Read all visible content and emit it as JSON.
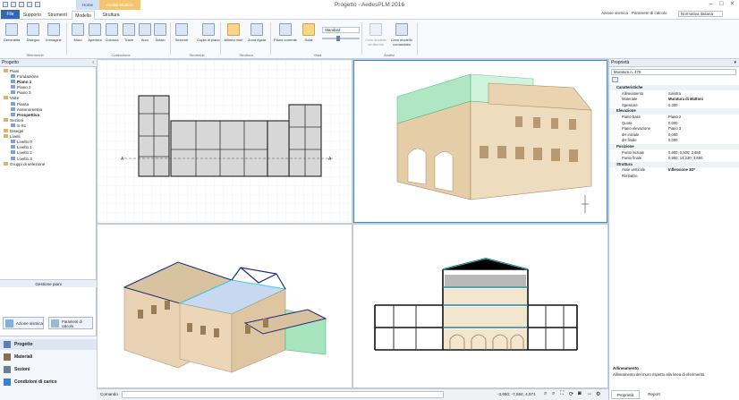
{
  "window": {
    "title": "Progetto - AedesPLM 2016"
  },
  "quick_access": {
    "context_tab": "Analisi Modello"
  },
  "tabs": [
    "File",
    "Supporto",
    "Strumenti",
    "Modello",
    "Struttura"
  ],
  "contextual_tabs": [
    "Home",
    "Analisi Modello"
  ],
  "top_right": {
    "analysis": "Azione sismica",
    "calc_params": "Parametri di calcolo",
    "norm": "Normativa italiana"
  },
  "ribbon": {
    "groups": [
      {
        "label": "Riferimenti",
        "buttons": [
          "Generalità",
          "Disegno",
          "Immagine"
        ]
      },
      {
        "label": "Costruzione",
        "buttons": [
          "Muro",
          "Apertura",
          "Colonna",
          "Trave",
          "Arco",
          "Solaio"
        ]
      },
      {
        "label": "Strumenti",
        "buttons": [
          "Sezione",
          "Copia di piano"
        ]
      },
      {
        "label": "Struttura",
        "buttons": [
          "Allinea muri",
          "Zona rigida"
        ]
      },
      {
        "label": "Vista",
        "buttons": [
          "Piano corrente",
          "Solai"
        ]
      },
      {
        "label": "Analisi",
        "buttons": [
          "Crea modello strutturale",
          "Crea modello comandato"
        ]
      }
    ],
    "view_select": "Standard"
  },
  "left_panel": {
    "header": "Progetto",
    "tree": [
      {
        "indent": 0,
        "label": "Piani",
        "bold": false
      },
      {
        "indent": 1,
        "label": "Fondazione",
        "bold": false
      },
      {
        "indent": 1,
        "label": "Piano 1",
        "bold": true
      },
      {
        "indent": 1,
        "label": "Piano 2",
        "bold": false
      },
      {
        "indent": 1,
        "label": "Piano 3",
        "bold": false
      },
      {
        "indent": 0,
        "label": "Viste",
        "bold": false
      },
      {
        "indent": 1,
        "label": "Pianta",
        "bold": false
      },
      {
        "indent": 1,
        "label": "Assonometria",
        "bold": false
      },
      {
        "indent": 1,
        "label": "Prospettiva",
        "bold": true
      },
      {
        "indent": 0,
        "label": "Sezioni",
        "bold": false
      },
      {
        "indent": 1,
        "label": "S-S1",
        "bold": false
      },
      {
        "indent": 0,
        "label": "Disegni",
        "bold": false
      },
      {
        "indent": 0,
        "label": "Livelli",
        "bold": false
      },
      {
        "indent": 1,
        "label": "Livello 0",
        "bold": false
      },
      {
        "indent": 1,
        "label": "Livello 1",
        "bold": false
      },
      {
        "indent": 1,
        "label": "Livello 2",
        "bold": false
      },
      {
        "indent": 1,
        "label": "Livello 3",
        "bold": false
      },
      {
        "indent": 0,
        "label": "Gruppi di selezione",
        "bold": false
      }
    ],
    "manager_label": "Gestione piani",
    "action_buttons": [
      "Azione sismica",
      "Parametri di calcolo"
    ],
    "nav_items": [
      "Progetto",
      "Materiali",
      "Sezioni",
      "Condizioni di carico"
    ]
  },
  "right_panel": {
    "header": "Proprietà",
    "selected": "Muratura n. 475",
    "rows": [
      {
        "type": "sec",
        "k": "Caratteristiche",
        "v": ""
      },
      {
        "type": "row",
        "k": "Allineamento",
        "v": "Sinistra"
      },
      {
        "type": "row",
        "k": "Materiale",
        "v": "Muratura di Mattoni",
        "bold": true
      },
      {
        "type": "row",
        "k": "Spessore",
        "v": "0,300"
      },
      {
        "type": "sec",
        "k": "Elevazione",
        "v": ""
      },
      {
        "type": "row",
        "k": "Piano base",
        "v": "Piano 2"
      },
      {
        "type": "row",
        "k": "Quota",
        "v": "0,000"
      },
      {
        "type": "row",
        "k": "Piano elevazione",
        "v": "Piano 3"
      },
      {
        "type": "row",
        "k": "dH iniziale",
        "v": "0,000"
      },
      {
        "type": "row",
        "k": "dH finale",
        "v": "0,000"
      },
      {
        "type": "sec",
        "k": "Posizione",
        "v": ""
      },
      {
        "type": "row",
        "k": "Punto iniziale",
        "v": "0,900; 0,500; 3,650"
      },
      {
        "type": "row",
        "k": "Punto finale",
        "v": "0,900; 14,230; 3,650"
      },
      {
        "type": "sec",
        "k": "Struttura",
        "v": ""
      },
      {
        "type": "row",
        "k": "Asse verticale",
        "v": "Inflessione 3D*",
        "bold": true
      },
      {
        "type": "row",
        "k": "Rimbalzo",
        "v": ""
      }
    ],
    "help_title": "Allineamento",
    "help_text": "Allineamento del muro rispetto alla linea di riferimento.",
    "footer_tabs": [
      "Proprietà",
      "Report"
    ]
  },
  "status": {
    "command_label": "Comando",
    "coords": "-3,650; -7,584; 4,571"
  },
  "colors": {
    "accent": "#2f66b8",
    "context": "#f3c56e",
    "wall": "#e8d2b3",
    "wall_dark": "#c9ad86",
    "glass": "#9ee0b2",
    "cyan": "#3fd0e0",
    "navy": "#1e2a78"
  }
}
